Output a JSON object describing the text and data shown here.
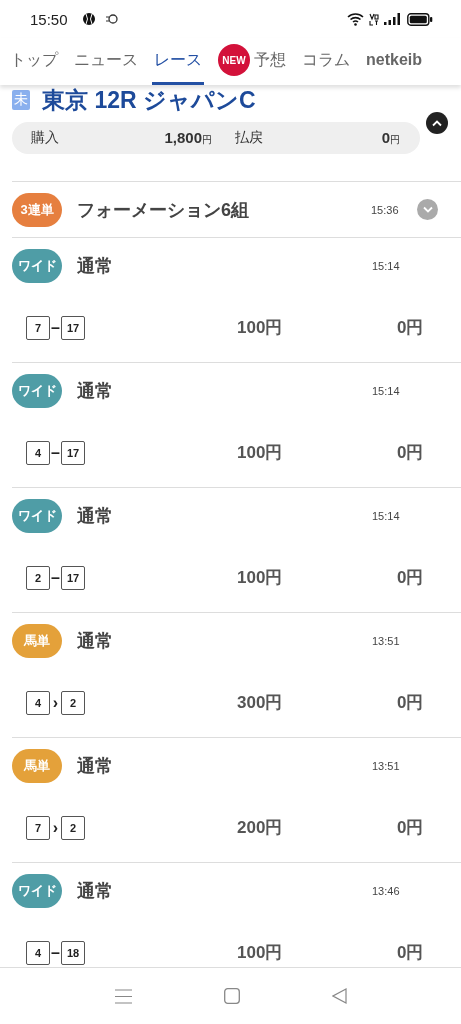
{
  "status_bar": {
    "time": "15:50"
  },
  "tabs": [
    {
      "label": "トップ",
      "selected": false
    },
    {
      "label": "ニュース",
      "selected": false
    },
    {
      "label": "レース",
      "selected": true
    },
    {
      "label": "予想",
      "selected": false,
      "badge": "NEW"
    },
    {
      "label": "コラム",
      "selected": false
    },
    {
      "label": "netkeib",
      "selected": false
    }
  ],
  "race": {
    "status": "未",
    "title": "東京 12R ジャパンC",
    "expanded": true,
    "purchase_label": "購入",
    "purchase": "1,800",
    "purchase_unit": "円",
    "payout_label": "払戻",
    "payout": "0",
    "payout_unit": "円"
  },
  "bets": [
    {
      "kind": "group",
      "type": "3連単",
      "color": "#e67f3f",
      "name": "フォーメーション6組",
      "time": "15:36",
      "expanded": false
    },
    {
      "kind": "single",
      "type": "ワイド",
      "color": "#4f9da6",
      "name": "通常",
      "time": "15:14",
      "horses": [
        "7",
        "17"
      ],
      "connector": "–",
      "amount": "100円",
      "payout": "0円"
    },
    {
      "kind": "single",
      "type": "ワイド",
      "color": "#4f9da6",
      "name": "通常",
      "time": "15:14",
      "horses": [
        "4",
        "17"
      ],
      "connector": "–",
      "amount": "100円",
      "payout": "0円"
    },
    {
      "kind": "single",
      "type": "ワイド",
      "color": "#4f9da6",
      "name": "通常",
      "time": "15:14",
      "horses": [
        "2",
        "17"
      ],
      "connector": "–",
      "amount": "100円",
      "payout": "0円"
    },
    {
      "kind": "single",
      "type": "馬単",
      "color": "#e4a13a",
      "name": "通常",
      "time": "13:51",
      "horses": [
        "4",
        "2"
      ],
      "connector": "›",
      "amount": "300円",
      "payout": "0円"
    },
    {
      "kind": "single",
      "type": "馬単",
      "color": "#e4a13a",
      "name": "通常",
      "time": "13:51",
      "horses": [
        "7",
        "2"
      ],
      "connector": "›",
      "amount": "200円",
      "payout": "0円"
    },
    {
      "kind": "single",
      "type": "ワイド",
      "color": "#4f9da6",
      "name": "通常",
      "time": "13:46",
      "horses": [
        "4",
        "18"
      ],
      "connector": "–",
      "amount": "100円",
      "payout": "0円"
    }
  ]
}
